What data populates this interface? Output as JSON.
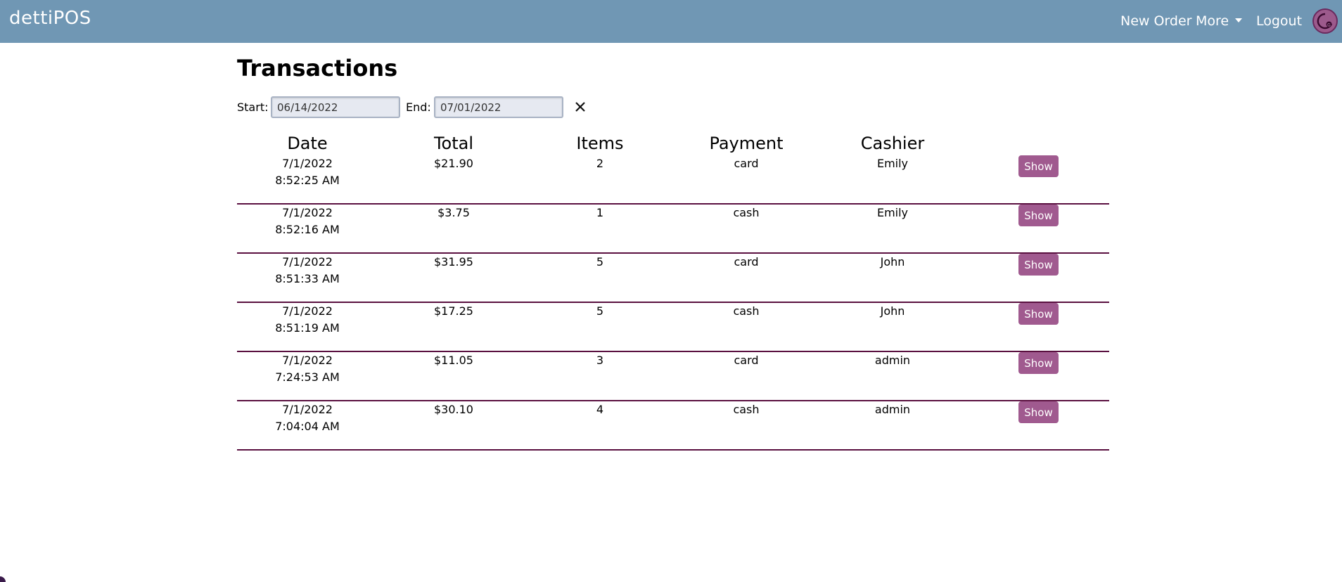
{
  "app": {
    "brand": "dettiPOS"
  },
  "nav": {
    "new_order": "New Order",
    "more": "More",
    "logout": "Logout"
  },
  "page": {
    "title": "Transactions"
  },
  "filters": {
    "start_label": "Start:",
    "start_value": "06/14/2022",
    "end_label": "End:",
    "end_value": "07/01/2022"
  },
  "table": {
    "headers": {
      "date": "Date",
      "total": "Total",
      "items": "Items",
      "payment": "Payment",
      "cashier": "Cashier"
    },
    "show_label": "Show",
    "rows": [
      {
        "date": "7/1/2022",
        "time": "8:52:25 AM",
        "total": "$21.90",
        "items": "2",
        "payment": "card",
        "cashier": "Emily"
      },
      {
        "date": "7/1/2022",
        "time": "8:52:16 AM",
        "total": "$3.75",
        "items": "1",
        "payment": "cash",
        "cashier": "Emily"
      },
      {
        "date": "7/1/2022",
        "time": "8:51:33 AM",
        "total": "$31.95",
        "items": "5",
        "payment": "card",
        "cashier": "John"
      },
      {
        "date": "7/1/2022",
        "time": "8:51:19 AM",
        "total": "$17.25",
        "items": "5",
        "payment": "cash",
        "cashier": "John"
      },
      {
        "date": "7/1/2022",
        "time": "7:24:53 AM",
        "total": "$11.05",
        "items": "3",
        "payment": "card",
        "cashier": "admin"
      },
      {
        "date": "7/1/2022",
        "time": "7:04:04 AM",
        "total": "$30.10",
        "items": "4",
        "payment": "cash",
        "cashier": "admin"
      }
    ]
  },
  "colors": {
    "navbar": "#7097b4",
    "accent": "#a05a8f",
    "row_divider": "#5a1040"
  }
}
